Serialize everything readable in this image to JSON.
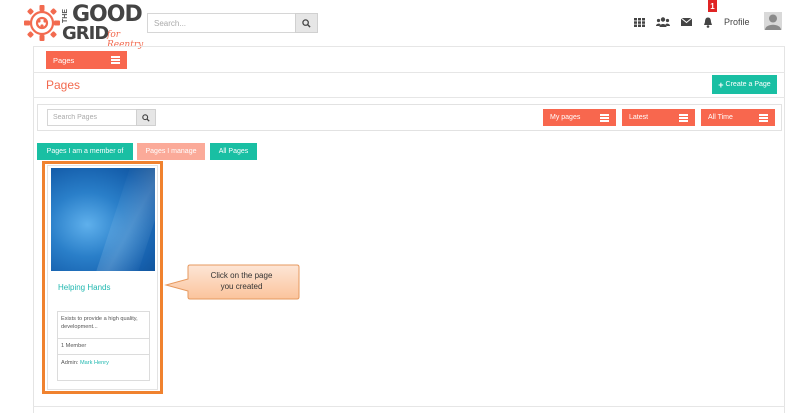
{
  "brand": {
    "the": "THE",
    "good": "GOOD",
    "grid": "GRID",
    "tagline": "for Reentry",
    "accent": "#f26a4f"
  },
  "header": {
    "search_placeholder": "Search...",
    "notification_count": "1",
    "profile_label": "Profile",
    "icons": [
      "search-icon",
      "apps-grid-icon",
      "groups-icon",
      "mail-icon",
      "bell-icon",
      "avatar-icon"
    ]
  },
  "tabs": {
    "pages_label": "Pages"
  },
  "page": {
    "title": "Pages",
    "create_label": "Create a Page"
  },
  "filters": {
    "search_placeholder": "Search Pages",
    "my_pages": "My pages",
    "latest": "Latest",
    "all_time": "All Time"
  },
  "chips": {
    "member": "Pages I am a member of",
    "manage": "Pages I manage",
    "all": "All Pages"
  },
  "card": {
    "name": "Helping Hands",
    "description": "Exists to provide a high quality, development...",
    "members": "1 Member",
    "admin_prefix": "Admin:",
    "admin_name": "Mark Henry"
  },
  "callout": {
    "text_line1": "Click on the page",
    "text_line2": "you created"
  },
  "colors": {
    "coral": "#f8674e",
    "teal": "#19bfa3",
    "coral_light": "#fbaa99",
    "highlight": "#f0822f"
  }
}
